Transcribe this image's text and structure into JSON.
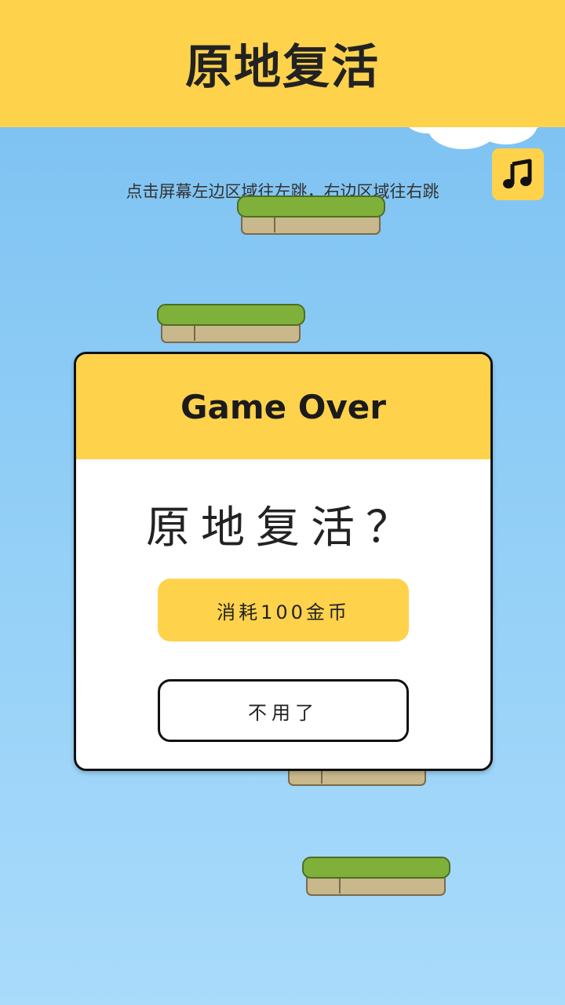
{
  "header": {
    "title": "原地复活"
  },
  "hint": "点击屏幕左边区域往左跳，右边区域往右跳",
  "music_button": {
    "icon": "music-note-icon"
  },
  "dialog": {
    "title": "Game Over",
    "question": "原地复活？",
    "revive_button_label": "消耗100金币",
    "decline_button_label": "不用了"
  },
  "colors": {
    "accent": "#ffd24c",
    "sky_top": "#79bff1",
    "sky_bottom": "#a9dbfb",
    "grass": "#7fb03a",
    "stone": "#c9b88c"
  }
}
